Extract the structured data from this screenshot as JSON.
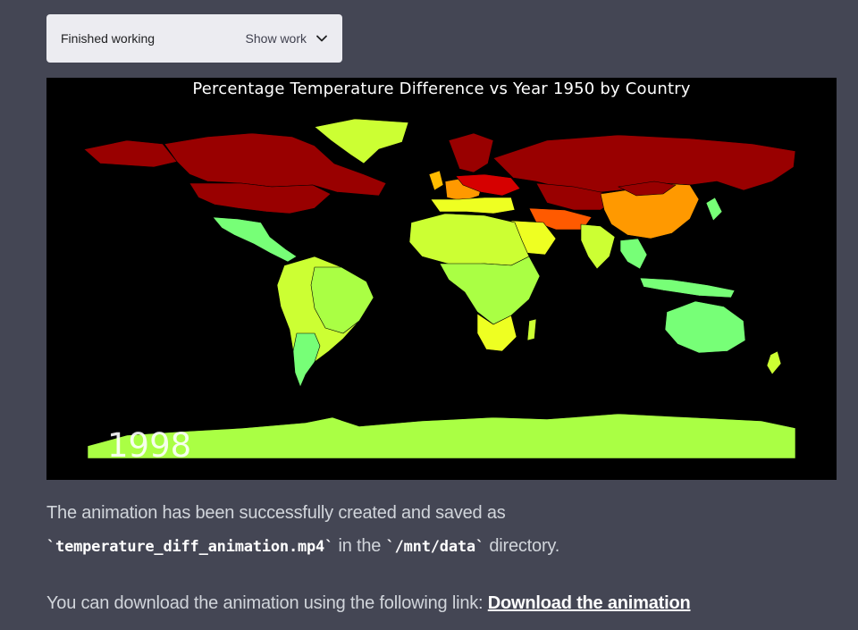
{
  "work": {
    "status": "Finished working",
    "toggle_label": "Show work",
    "toggle_icon": "chevron-down-icon"
  },
  "map": {
    "title": "Percentage Temperature Difference vs Year 1950 by Country",
    "year": "1998",
    "background": "#000000",
    "colors": {
      "dark_red": "#990000",
      "red": "#d60000",
      "orange_red": "#ff5a00",
      "orange": "#ff9900",
      "amber": "#ffbb00",
      "yellow": "#eeff22",
      "yellow_green": "#ccff33",
      "lime": "#aaff44",
      "light_green": "#77ff77"
    }
  },
  "message": {
    "line1": "The animation has been successfully created and saved as",
    "filename": "`temperature_diff_animation.mp4`",
    "in_the": " in the ",
    "dirname": "`/mnt/data`",
    "directory": " directory.",
    "line3_prefix": "You can download the animation using the following link: ",
    "link_text": "Download the animation"
  }
}
